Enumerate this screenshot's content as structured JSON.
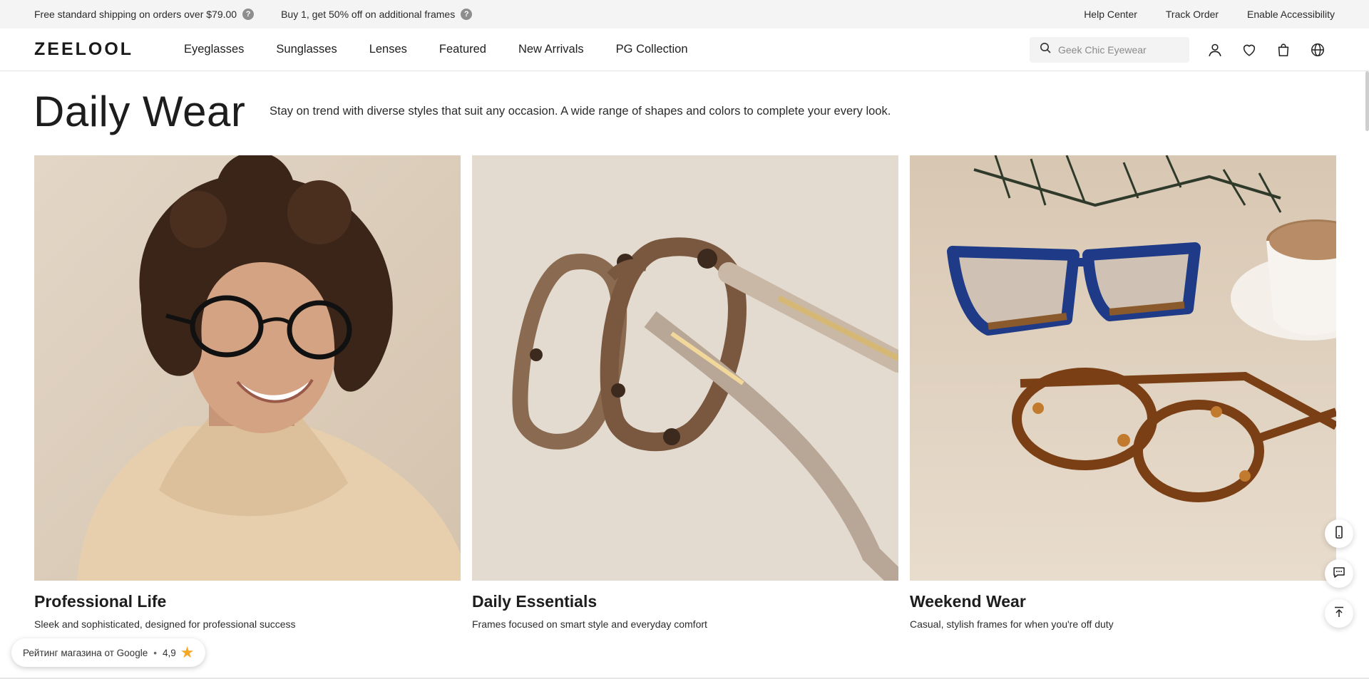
{
  "topbar": {
    "promos": [
      {
        "text": "Free standard shipping on orders over $79.00"
      },
      {
        "text": "Buy 1, get 50% off on additional frames"
      }
    ],
    "help_glyph": "?",
    "links": [
      "Help Center",
      "Track Order",
      "Enable Accessibility"
    ]
  },
  "header": {
    "logo": "ZEELOOL",
    "nav": [
      "Eyeglasses",
      "Sunglasses",
      "Lenses",
      "Featured",
      "New Arrivals",
      "PG Collection"
    ],
    "search": {
      "placeholder": "Geek Chic Eyewear",
      "value": ""
    },
    "icons": [
      "account-icon",
      "wishlist-icon",
      "cart-icon",
      "language-icon"
    ]
  },
  "main": {
    "title": "Daily Wear",
    "description": "Stay on trend with diverse styles that suit any occasion. A wide range of shapes and colors to complete your every look.",
    "cards": [
      {
        "title": "Professional Life",
        "subtitle": "Sleek and sophisticated, designed for professional success",
        "image": "woman-with-glasses-photo"
      },
      {
        "title": "Daily Essentials",
        "subtitle": "Frames focused on smart style and everyday comfort",
        "image": "tortoise-frames-photo"
      },
      {
        "title": "Weekend Wear",
        "subtitle": "Casual, stylish frames for when you're off duty",
        "image": "two-glasses-with-coffee-photo"
      }
    ]
  },
  "floating": [
    "mobile-app-icon",
    "chat-icon",
    "back-to-top-icon"
  ],
  "rating_badge": {
    "label": "Рейтинг магазина от Google",
    "separator": "•",
    "score": "4,9",
    "star": "★"
  },
  "colors": {
    "topbar_bg": "#f4f4f4",
    "text": "#222222",
    "star": "#f5a623",
    "search_bg": "#f3f3f3"
  }
}
